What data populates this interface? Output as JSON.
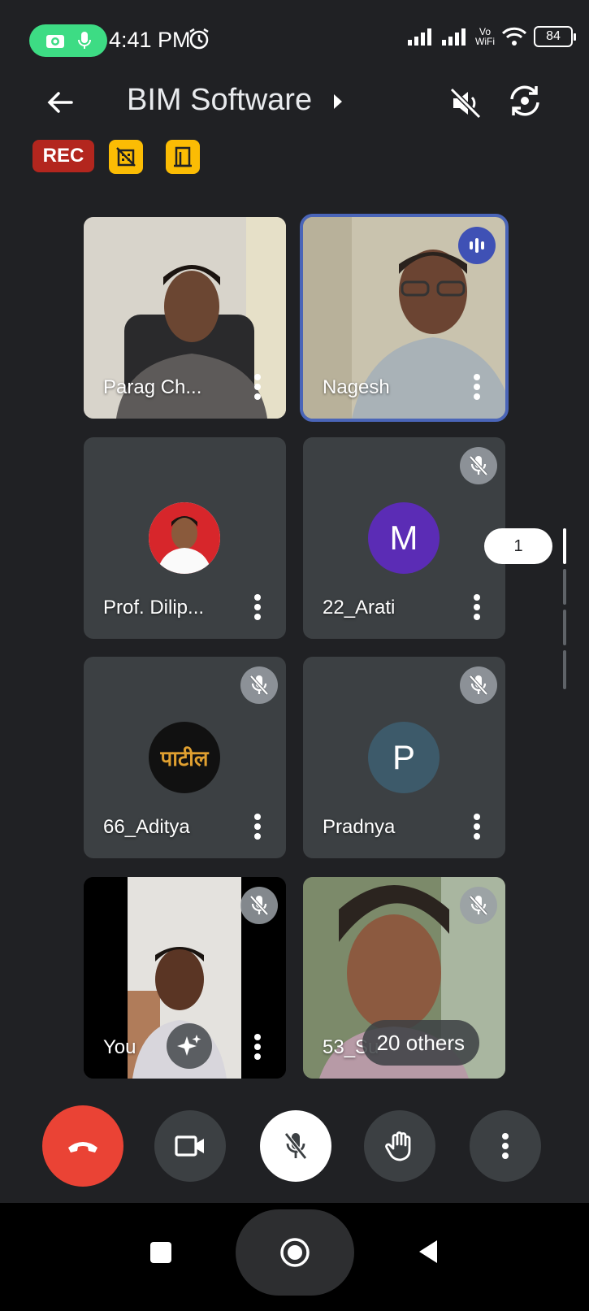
{
  "status_bar": {
    "time": "4:41 PM",
    "battery": "84",
    "vowifi_top": "Vo",
    "vowifi_bottom": "WiFi"
  },
  "header": {
    "title": "BIM Software",
    "recording_label": "REC"
  },
  "participants": [
    {
      "name": "Parag Ch...",
      "type": "video",
      "speaking": false,
      "muted": false
    },
    {
      "name": "Nagesh",
      "type": "video",
      "speaking": true,
      "muted": false
    },
    {
      "name": "Prof. Dilip...",
      "type": "photo-avatar",
      "muted": false
    },
    {
      "name": "22_Arati",
      "type": "letter-avatar",
      "initial": "M",
      "avatar_color": "#5b2cb5",
      "muted": true
    },
    {
      "name": "66_Aditya",
      "type": "photo-avatar",
      "avatar_text": "पाटील",
      "muted": true
    },
    {
      "name": "Pradnya",
      "type": "letter-avatar",
      "initial": "P",
      "avatar_color": "#3d5a6a",
      "muted": true
    },
    {
      "name": "You",
      "type": "video",
      "muted": true
    },
    {
      "name": "53_Su",
      "type": "video",
      "muted": true
    }
  ],
  "others_chip": "20 others",
  "page_indicator": "1",
  "colors": {
    "end_call": "#ea4335",
    "rec_badge": "#b3261e",
    "host_badge": "#fbbc04",
    "speaking_outline": "#4a65b8"
  }
}
